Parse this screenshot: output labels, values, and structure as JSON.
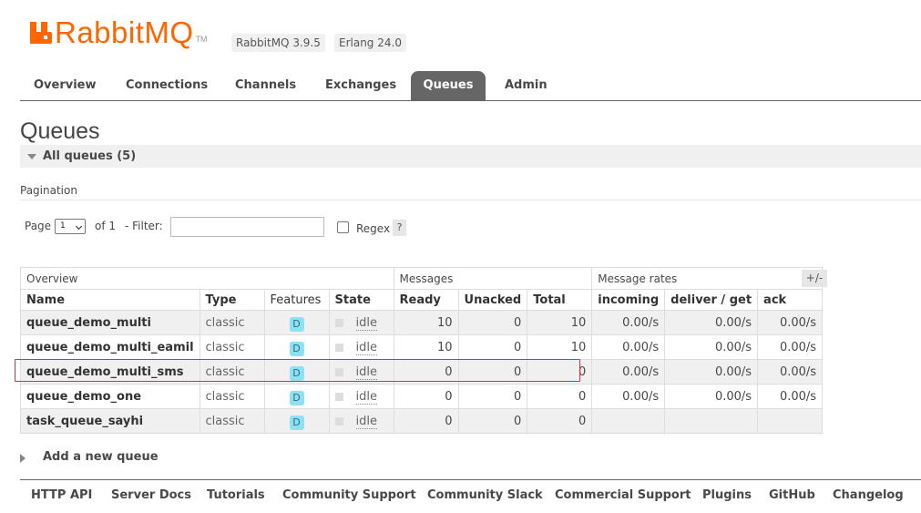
{
  "header": {
    "logo_text": "RabbitMQ",
    "logo_tm": "TM",
    "rabbit_version": "RabbitMQ 3.9.5",
    "erlang_version": "Erlang 24.0",
    "brand_color": "#ff6600"
  },
  "tabs": [
    {
      "label": "Overview"
    },
    {
      "label": "Connections"
    },
    {
      "label": "Channels"
    },
    {
      "label": "Exchanges"
    },
    {
      "label": "Queues",
      "active": true
    },
    {
      "label": "Admin"
    }
  ],
  "page_title": "Queues",
  "section": {
    "title": "All queues (5)"
  },
  "pagination": {
    "label": "Pagination",
    "page_label": "Page",
    "page_value": "1",
    "of_label": "of 1",
    "filter_label": "- Filter:",
    "filter_value": "",
    "regex_label": "Regex",
    "help_label": "?"
  },
  "table": {
    "groups": {
      "overview": "Overview",
      "messages": "Messages",
      "rates": "Message rates"
    },
    "columns": {
      "name": "Name",
      "type": "Type",
      "features": "Features",
      "state": "State",
      "ready": "Ready",
      "unacked": "Unacked",
      "total": "Total",
      "incoming": "incoming",
      "deliver_get": "deliver / get",
      "ack": "ack"
    },
    "toggle_columns": "+/-",
    "rows": [
      {
        "name": "queue_demo_multi",
        "type": "classic",
        "feature": "D",
        "state": "idle",
        "ready": "10",
        "unacked": "0",
        "total": "10",
        "incoming": "0.00/s",
        "deliver_get": "0.00/s",
        "ack": "0.00/s"
      },
      {
        "name": "queue_demo_multi_eamil",
        "type": "classic",
        "feature": "D",
        "state": "idle",
        "ready": "10",
        "unacked": "0",
        "total": "10",
        "incoming": "0.00/s",
        "deliver_get": "0.00/s",
        "ack": "0.00/s"
      },
      {
        "name": "queue_demo_multi_sms",
        "type": "classic",
        "feature": "D",
        "state": "idle",
        "ready": "0",
        "unacked": "0",
        "total": "0",
        "incoming": "0.00/s",
        "deliver_get": "0.00/s",
        "ack": "0.00/s"
      },
      {
        "name": "queue_demo_one",
        "type": "classic",
        "feature": "D",
        "state": "idle",
        "ready": "0",
        "unacked": "0",
        "total": "0",
        "incoming": "0.00/s",
        "deliver_get": "0.00/s",
        "ack": "0.00/s"
      },
      {
        "name": "task_queue_sayhi",
        "type": "classic",
        "feature": "D",
        "state": "idle",
        "ready": "0",
        "unacked": "0",
        "total": "0",
        "incoming": "",
        "deliver_get": "",
        "ack": ""
      }
    ]
  },
  "add_queue_label": "Add a new queue",
  "footer": [
    {
      "label": "HTTP API"
    },
    {
      "label": "Server Docs"
    },
    {
      "label": "Tutorials"
    },
    {
      "label": "Community Support"
    },
    {
      "label": "Community Slack"
    },
    {
      "label": "Commercial Support"
    },
    {
      "label": "Plugins"
    },
    {
      "label": "GitHub"
    },
    {
      "label": "Changelog"
    }
  ]
}
